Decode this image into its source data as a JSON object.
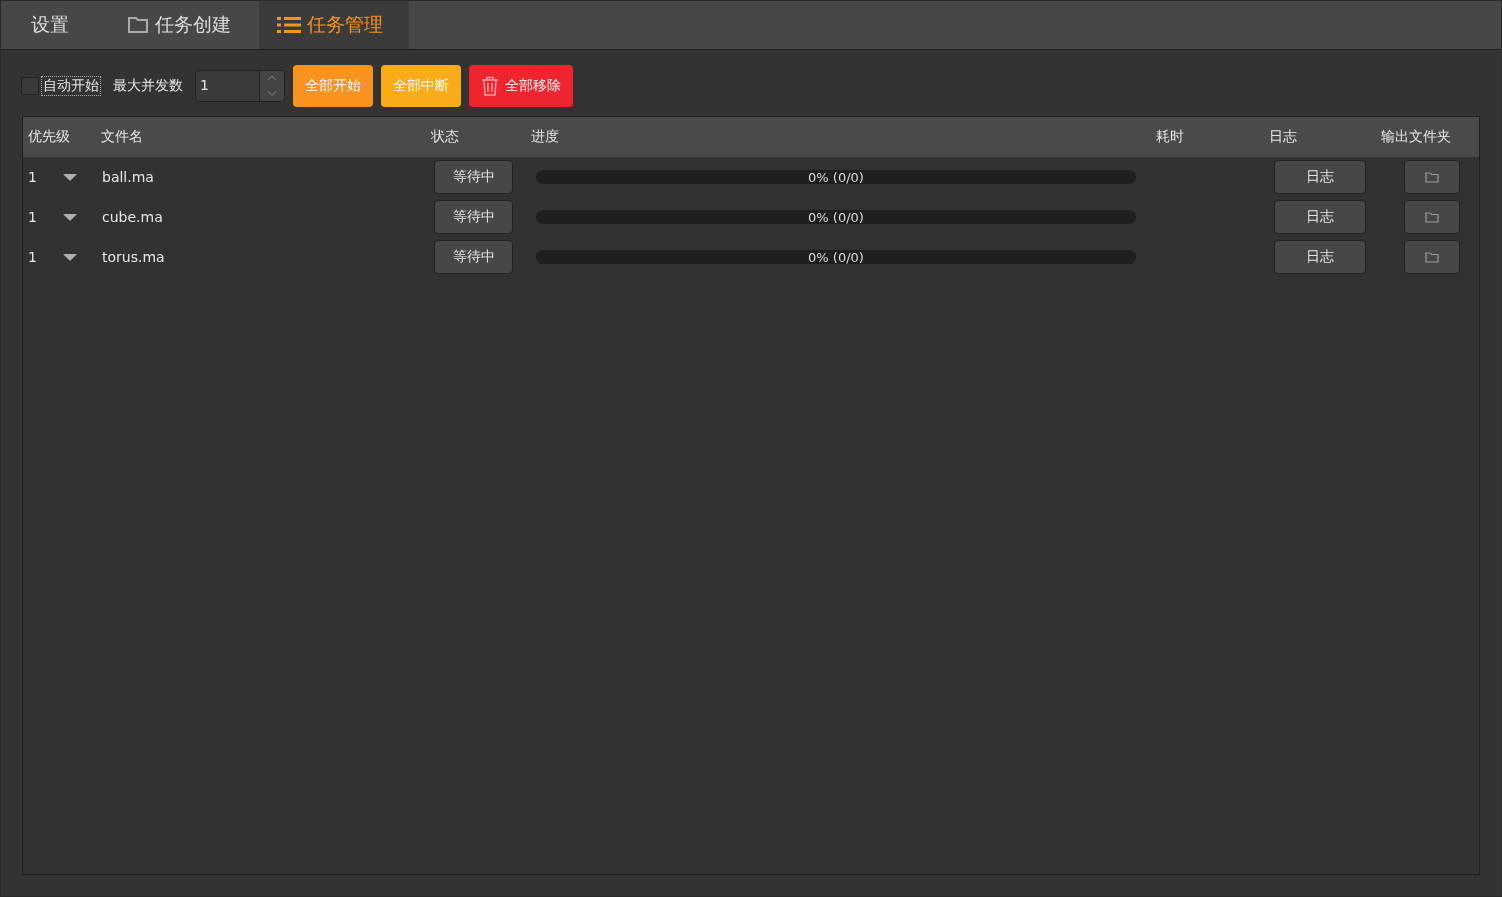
{
  "tabs": [
    {
      "label": "设置",
      "kind": "plain",
      "selected": false
    },
    {
      "label": "任务创建",
      "kind": "folder",
      "selected": false
    },
    {
      "label": "任务管理",
      "kind": "list",
      "selected": true
    }
  ],
  "toolbar": {
    "auto_start": {
      "label": "自动开始",
      "checked": false
    },
    "max_concurrency": {
      "label": "最大并发数",
      "value": "1"
    },
    "buttons": [
      {
        "label": "全部开始",
        "color": "#f7931e",
        "kind": "plain"
      },
      {
        "label": "全部中断",
        "color": "#f9ab1a",
        "kind": "plain"
      },
      {
        "label": "全部移除",
        "color": "#f0242f",
        "kind": "trash"
      }
    ]
  },
  "table": {
    "columns": [
      "优先级",
      "文件名",
      "状态",
      "进度",
      "耗时",
      "日志",
      "输出文件夹"
    ],
    "rows": [
      {
        "priority": "1",
        "file": "ball.ma",
        "status": "等待中",
        "level": 0,
        "progress": "0% (0/0)",
        "log": "日志"
      },
      {
        "priority": "1",
        "file": "cube.ma",
        "status": "等待中",
        "level": 0,
        "progress": "0% (0/0)",
        "log": "日志"
      },
      {
        "priority": "1",
        "file": "torus.ma",
        "status": "等待中",
        "level": 0,
        "progress": "0% (0/0)",
        "log": "日志"
      }
    ]
  }
}
